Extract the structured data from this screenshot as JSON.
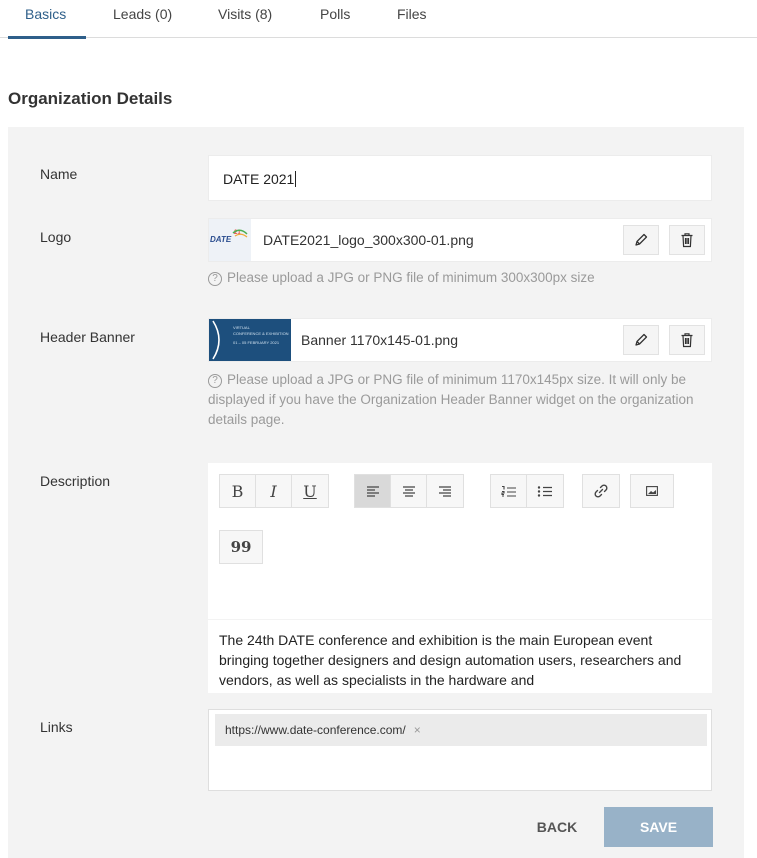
{
  "tabs": [
    "Basics",
    "Leads (0)",
    "Visits (8)",
    "Polls",
    "Files"
  ],
  "section_title": "Organization Details",
  "fields": {
    "name": {
      "label": "Name",
      "value": "DATE 2021"
    },
    "logo": {
      "label": "Logo",
      "file_name": "DATE2021_logo_300x300-01.png",
      "thumb_text": "DATE",
      "thumb_super": "21",
      "help": "Please upload a JPG or PNG file of minimum 300x300px size"
    },
    "header_banner": {
      "label": "Header Banner",
      "file_name": "Banner 1170x145-01.png",
      "thumb_line1": "VIRTUAL",
      "thumb_line2": "CONFERENCE & EXHIBITION",
      "thumb_line3": "01 – 05 FEBRUARY 2021",
      "help": "Please upload a JPG or PNG file of minimum 1170x145px size. It will only be displayed if you have the Organization Header Banner widget on the organization details page."
    },
    "description": {
      "label": "Description",
      "toolbar": {
        "bold": "B",
        "italic": "I",
        "underline": "U",
        "align_left": "align-left-icon",
        "align_center": "align-center-icon",
        "align_right": "align-right-icon",
        "ordered_list": "ordered-list-icon",
        "bullet_list": "bullet-list-icon",
        "link": "link-icon",
        "image": "image-icon",
        "quote": "99"
      },
      "text": "The 24th DATE conference and exhibition is the main European event bringing together designers and design automation users, researchers and vendors, as well as specialists in the hardware and"
    },
    "links": {
      "label": "Links",
      "items": [
        "https://www.date-conference.com/"
      ],
      "remove_glyph": "×"
    }
  },
  "buttons": {
    "back": "BACK",
    "save": "SAVE"
  },
  "help_glyph": "?",
  "colors": {
    "accent": "#2e5f8a",
    "save_disabled": "#98b2c8",
    "panel_bg": "#f3f3f3",
    "help_text": "#9a9a9a"
  }
}
